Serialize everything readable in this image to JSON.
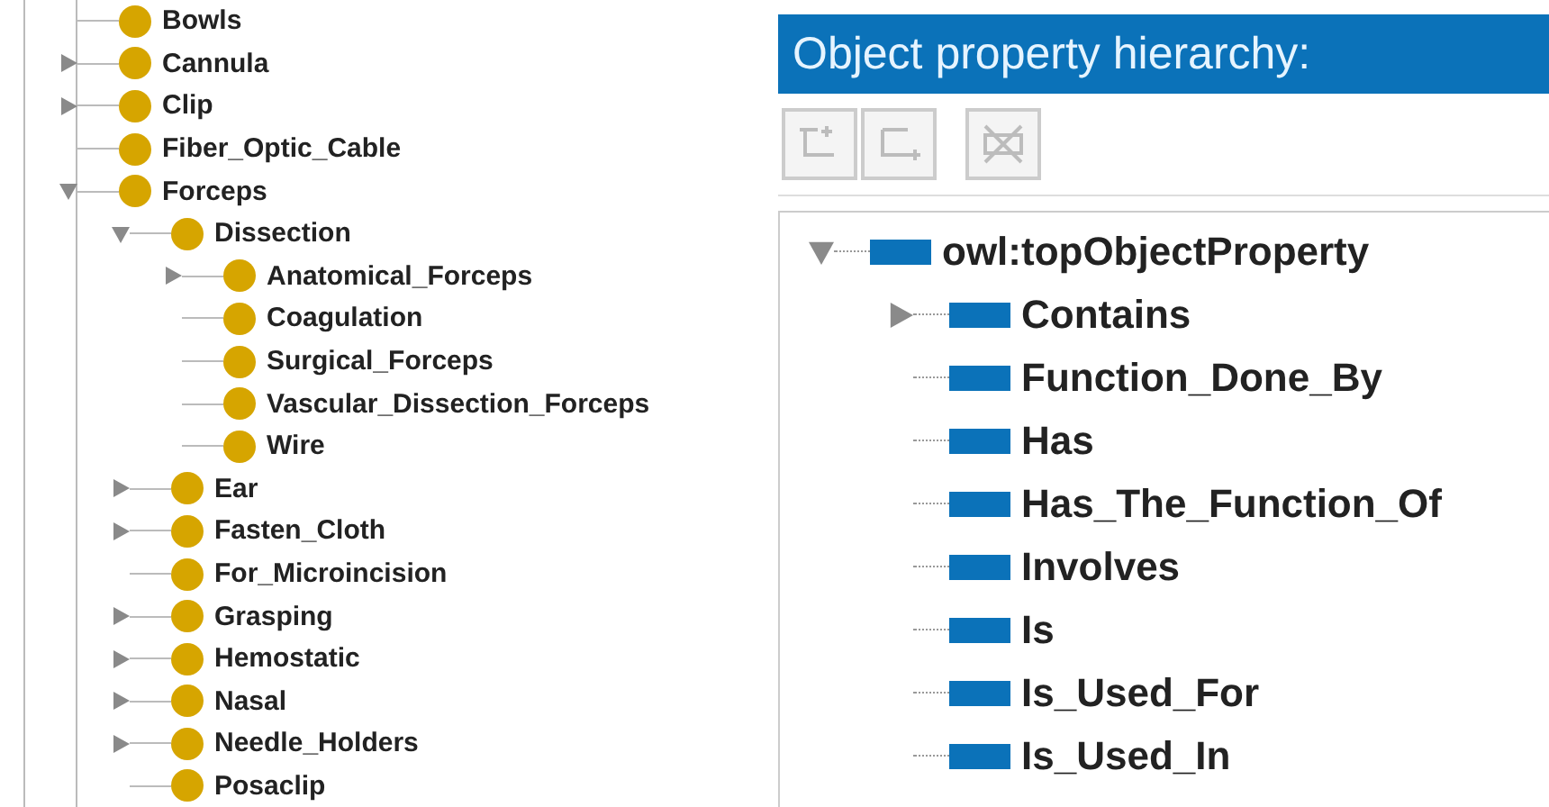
{
  "class_tree": {
    "items": [
      {
        "label": "Bowls",
        "kind": "leaf"
      },
      {
        "label": "Cannula",
        "kind": "branch",
        "expanded": false
      },
      {
        "label": "Clip",
        "kind": "branch",
        "expanded": false
      },
      {
        "label": "Fiber_Optic_Cable",
        "kind": "leaf"
      },
      {
        "label": "Forceps",
        "kind": "branch",
        "expanded": true,
        "children": [
          {
            "label": "Dissection",
            "kind": "branch",
            "expanded": true,
            "children": [
              {
                "label": "Anatomical_Forceps",
                "kind": "branch",
                "expanded": false
              },
              {
                "label": "Coagulation",
                "kind": "leaf"
              },
              {
                "label": "Surgical_Forceps",
                "kind": "leaf"
              },
              {
                "label": "Vascular_Dissection_Forceps",
                "kind": "leaf"
              },
              {
                "label": "Wire",
                "kind": "leaf"
              }
            ]
          },
          {
            "label": "Ear",
            "kind": "branch",
            "expanded": false
          },
          {
            "label": "Fasten_Cloth",
            "kind": "branch",
            "expanded": false
          },
          {
            "label": "For_Microincision",
            "kind": "leaf"
          },
          {
            "label": "Grasping",
            "kind": "branch",
            "expanded": false
          },
          {
            "label": "Hemostatic",
            "kind": "branch",
            "expanded": false
          },
          {
            "label": "Nasal",
            "kind": "branch",
            "expanded": false
          },
          {
            "label": "Needle_Holders",
            "kind": "branch",
            "expanded": false
          },
          {
            "label": "Posaclip",
            "kind": "leaf"
          }
        ]
      }
    ]
  },
  "property_panel": {
    "title": "Object property hierarchy:",
    "toolbar": [
      {
        "kind": "add_sub",
        "disabled": true
      },
      {
        "kind": "add_sibling",
        "disabled": true
      },
      {
        "kind": "delete",
        "disabled": true
      }
    ],
    "tree": {
      "items": [
        {
          "label": "owl:topObjectProperty",
          "kind": "branch",
          "expanded": true,
          "children": [
            {
              "label": "Contains",
              "kind": "branch",
              "expanded": false
            },
            {
              "label": "Function_Done_By",
              "kind": "leaf"
            },
            {
              "label": "Has",
              "kind": "leaf"
            },
            {
              "label": "Has_The_Function_Of",
              "kind": "leaf"
            },
            {
              "label": "Involves",
              "kind": "leaf"
            },
            {
              "label": "Is",
              "kind": "leaf"
            },
            {
              "label": "Is_Used_For",
              "kind": "leaf"
            },
            {
              "label": "Is_Used_In",
              "kind": "leaf"
            }
          ]
        }
      ]
    }
  }
}
